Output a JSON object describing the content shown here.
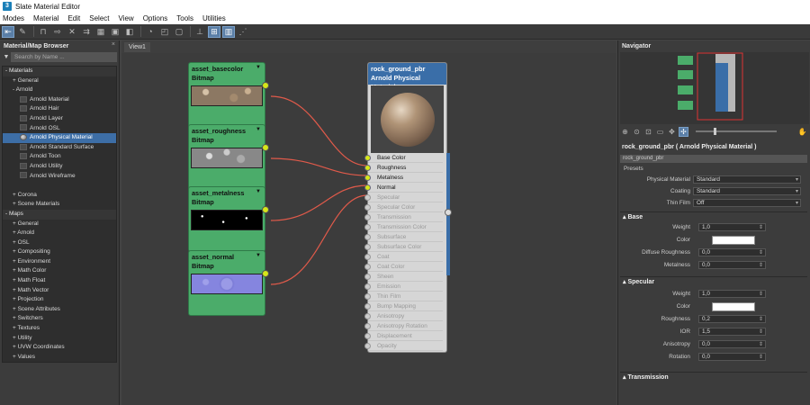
{
  "window": {
    "title": "Slate Material Editor"
  },
  "menu": [
    "Modes",
    "Material",
    "Edit",
    "Select",
    "View",
    "Options",
    "Tools",
    "Utilities"
  ],
  "browser": {
    "title": "Material/Map Browser",
    "search_placeholder": "Search by Name ...",
    "rows": [
      {
        "t": "- Materials",
        "k": "head",
        "d": 0
      },
      {
        "t": "+ General",
        "k": "item",
        "d": 1
      },
      {
        "t": "- Arnold",
        "k": "item",
        "d": 1
      },
      {
        "t": "Arnold Material",
        "k": "mat",
        "d": 2
      },
      {
        "t": "Arnold Hair",
        "k": "mat",
        "d": 2
      },
      {
        "t": "Arnold Layer",
        "k": "mat",
        "d": 2
      },
      {
        "t": "Arnold OSL",
        "k": "mat",
        "d": 2
      },
      {
        "t": "Arnold Physical Material",
        "k": "sel",
        "d": 2
      },
      {
        "t": "Arnold Standard Surface",
        "k": "mat",
        "d": 2
      },
      {
        "t": "Arnold Toon",
        "k": "mat",
        "d": 2
      },
      {
        "t": "Arnold Utility",
        "k": "mat",
        "d": 2
      },
      {
        "t": "Arnold Wireframe",
        "k": "mat",
        "d": 2
      },
      {
        "t": "",
        "k": "gap",
        "d": 0
      },
      {
        "t": "+ Corona",
        "k": "item",
        "d": 1
      },
      {
        "t": "+ Scene Materials",
        "k": "item",
        "d": 1
      },
      {
        "t": "- Maps",
        "k": "head",
        "d": 0
      },
      {
        "t": "+ General",
        "k": "item",
        "d": 1
      },
      {
        "t": "+ Arnold",
        "k": "item",
        "d": 1
      },
      {
        "t": "+ OSL",
        "k": "item",
        "d": 1
      },
      {
        "t": "+ Compositing",
        "k": "item",
        "d": 1
      },
      {
        "t": "+ Environment",
        "k": "item",
        "d": 1
      },
      {
        "t": "+ Math Color",
        "k": "item",
        "d": 1
      },
      {
        "t": "+ Math Float",
        "k": "item",
        "d": 1
      },
      {
        "t": "+ Math Vector",
        "k": "item",
        "d": 1
      },
      {
        "t": "+ Projection",
        "k": "item",
        "d": 1
      },
      {
        "t": "+ Scene Attributes",
        "k": "item",
        "d": 1
      },
      {
        "t": "+ Switchers",
        "k": "item",
        "d": 1
      },
      {
        "t": "+ Textures",
        "k": "item",
        "d": 1
      },
      {
        "t": "+ Utility",
        "k": "item",
        "d": 1
      },
      {
        "t": "+ UVW Coordinates",
        "k": "item",
        "d": 1
      },
      {
        "t": "+ Values",
        "k": "item",
        "d": 1
      }
    ]
  },
  "view": {
    "tab": "View1"
  },
  "nodes": [
    {
      "name": "asset_basecolor",
      "type": "Bitmap",
      "thumb": "t-rock"
    },
    {
      "name": "asset_roughness",
      "type": "Bitmap",
      "thumb": "t-rough"
    },
    {
      "name": "asset_metalness",
      "type": "Bitmap",
      "thumb": "t-metal"
    },
    {
      "name": "asset_normal",
      "type": "Bitmap",
      "thumb": "t-norm"
    }
  ],
  "material": {
    "name": "rock_ground_pbr",
    "type": "Arnold Physical Material",
    "slots": [
      {
        "n": "Base Color",
        "a": true
      },
      {
        "n": "Roughness",
        "a": true
      },
      {
        "n": "Metalness",
        "a": true
      },
      {
        "n": "Normal",
        "a": true
      },
      {
        "n": "Specular",
        "a": false
      },
      {
        "n": "Specular Color",
        "a": false
      },
      {
        "n": "Transmission",
        "a": false
      },
      {
        "n": "Transmission Color",
        "a": false
      },
      {
        "n": "Subsurface",
        "a": false
      },
      {
        "n": "Subsurface Color",
        "a": false
      },
      {
        "n": "Coat",
        "a": false
      },
      {
        "n": "Coat Color",
        "a": false
      },
      {
        "n": "Sheen",
        "a": false
      },
      {
        "n": "Emission",
        "a": false
      },
      {
        "n": "Thin Film",
        "a": false
      },
      {
        "n": "Bump Mapping",
        "a": false
      },
      {
        "n": "Anisotropy",
        "a": false
      },
      {
        "n": "Anisotropy Rotation",
        "a": false
      },
      {
        "n": "Displacement",
        "a": false
      },
      {
        "n": "Opacity",
        "a": false
      }
    ]
  },
  "navigator": {
    "title": "Navigator"
  },
  "props": {
    "title": "rock_ground_pbr  ( Arnold Physical Material )",
    "name_field": "rock_ground_pbr",
    "presets_label": "Presets",
    "physical_material": {
      "label": "Physical Material",
      "value": "Standard"
    },
    "coating": {
      "label": "Coating",
      "value": "Standard"
    },
    "thin_film": {
      "label": "Thin Film",
      "value": "Off"
    },
    "base": {
      "title": "Base",
      "weight_label": "Weight",
      "weight": "1,0",
      "color_label": "Color",
      "diffuse_label": "Diffuse Roughness",
      "diffuse": "0,0",
      "metalness_label": "Metalness",
      "metalness": "0,0"
    },
    "specular": {
      "title": "Specular",
      "weight_label": "Weight",
      "weight": "1,0",
      "color_label": "Color",
      "roughness_label": "Roughness",
      "roughness": "0,2",
      "ior_label": "IOR",
      "ior": "1,5",
      "aniso_label": "Anisotropy",
      "aniso": "0,0",
      "rotation_label": "Rotation",
      "rotation": "0,0"
    },
    "transmission": {
      "title": "Transmission"
    }
  },
  "colors": {
    "accent": "#3d6ea6",
    "node_green": "#4bac6a",
    "wire": "#e05a4a",
    "socket": "#d6e619"
  }
}
